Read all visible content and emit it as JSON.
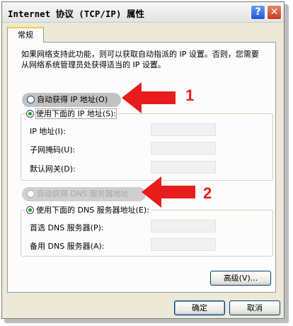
{
  "window": {
    "title": "Internet 协议 (TCP/IP) 属性",
    "help_label": "?",
    "close_label": "✕"
  },
  "tab": {
    "label": "常规"
  },
  "description": "如果网络支持此功能，则可以获取自动指派的 IP 设置。否则，您需要从网络系统管理员处获得适当的 IP 设置。",
  "ip_options": {
    "auto_label": "自动获得 IP 地址(O)",
    "manual_label": "使用下面的 IP 地址(S):",
    "selected": "manual"
  },
  "ip_fields": [
    {
      "label": "IP 地址(I):",
      "value": ""
    },
    {
      "label": "子网掩码(U):",
      "value": ""
    },
    {
      "label": "默认网关(D):",
      "value": ""
    }
  ],
  "dns_options": {
    "auto_label": "自动获得 DNS 服务器地址",
    "manual_label": "使用下面的 DNS 服务器地址(E):",
    "selected": "manual"
  },
  "dns_fields": [
    {
      "label": "首选 DNS 服务器(P):",
      "value": ""
    },
    {
      "label": "备用 DNS 服务器(A):",
      "value": ""
    }
  ],
  "buttons": {
    "advanced": "高级(V)...",
    "ok": "确定",
    "cancel": "取消"
  },
  "annotations": {
    "marker_1": "1",
    "marker_2": "2",
    "arrow_color": "#e81c1c"
  }
}
